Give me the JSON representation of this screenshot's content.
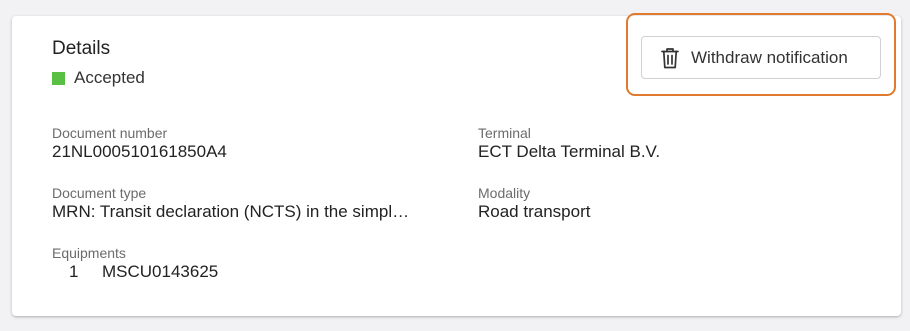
{
  "details": {
    "title": "Details",
    "status": {
      "label": "Accepted",
      "color": "#5ac043"
    }
  },
  "actions": {
    "withdraw_label": "Withdraw notification",
    "withdraw_icon": "trash-icon",
    "highlight_color": "#e07a2e"
  },
  "fields": {
    "document_number": {
      "label": "Document number",
      "value": "21NL000510161850A4"
    },
    "terminal": {
      "label": "Terminal",
      "value": "ECT Delta Terminal B.V."
    },
    "document_type": {
      "label": "Document type",
      "value": "MRN: Transit declaration (NCTS) in the simpl…"
    },
    "modality": {
      "label": "Modality",
      "value": "Road transport"
    },
    "equipments": {
      "label": "Equipments",
      "items": [
        {
          "index": "1",
          "code": "MSCU0143625"
        }
      ]
    }
  }
}
